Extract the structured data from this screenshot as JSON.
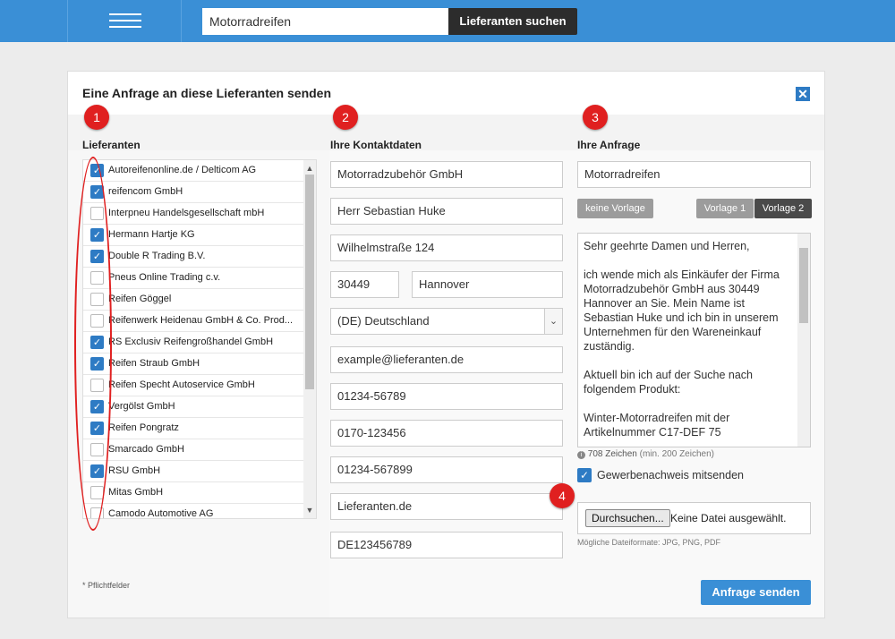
{
  "header": {
    "search_value": "Motorradreifen",
    "search_button": "Lieferanten suchen"
  },
  "dialog": {
    "title": "Eine Anfrage an diese Lieferanten senden",
    "close_icon": "close-icon",
    "steps": [
      "1",
      "2",
      "3",
      "4"
    ],
    "required_note": "* Pflichtfelder",
    "submit_label": "Anfrage senden"
  },
  "suppliers": {
    "heading": "Lieferanten",
    "items": [
      {
        "label": "Autoreifenonline.de / Delticom AG",
        "checked": true
      },
      {
        "label": "reifencom GmbH",
        "checked": true
      },
      {
        "label": "Interpneu Handelsgesellschaft mbH",
        "checked": false
      },
      {
        "label": "Hermann Hartje KG",
        "checked": true
      },
      {
        "label": "Double R Trading B.V.",
        "checked": true
      },
      {
        "label": "Pneus Online Trading c.v.",
        "checked": false
      },
      {
        "label": "Reifen Göggel",
        "checked": false
      },
      {
        "label": "Reifenwerk Heidenau GmbH & Co. Prod...",
        "checked": false
      },
      {
        "label": "RS Exclusiv Reifengroßhandel GmbH",
        "checked": true
      },
      {
        "label": "Reifen Straub GmbH",
        "checked": true
      },
      {
        "label": "Reifen Specht Autoservice GmbH",
        "checked": false
      },
      {
        "label": "Vergölst GmbH",
        "checked": true
      },
      {
        "label": "Reifen Pongratz",
        "checked": true
      },
      {
        "label": "Smarcado GmbH",
        "checked": false
      },
      {
        "label": "RSU GmbH",
        "checked": true
      },
      {
        "label": "Mitas GmbH",
        "checked": false
      },
      {
        "label": "Camodo Automotive AG",
        "checked": false
      }
    ]
  },
  "contact": {
    "heading": "Ihre Kontaktdaten",
    "company": "Motorradzubehör GmbH",
    "name": "Herr Sebastian Huke",
    "street": "Wilhelmstraße 124",
    "zip": "30449",
    "city": "Hannover",
    "country": "(DE) Deutschland",
    "email": "example@lieferanten.de",
    "phone": "01234-56789",
    "mobile": "0170-123456",
    "fax": "01234-567899",
    "website": "Lieferanten.de",
    "vat_id": "DE123456789"
  },
  "request": {
    "heading": "Ihre Anfrage",
    "subject": "Motorradreifen",
    "template_none": "keine Vorlage",
    "template_1": "Vorlage 1",
    "template_2": "Vorlage 2",
    "message": "Sehr geehrte Damen und Herren,\n\nich wende mich als Einkäufer der Firma Motorradzubehör GmbH aus 30449 Hannover an Sie. Mein Name ist Sebastian Huke und ich bin in unserem Unternehmen für den Wareneinkauf zuständig.\n\nAktuell bin ich auf der Suche nach folgendem Produkt:\n\nWinter-Motorradreifen mit der Artikelnummer C17-DEF 75",
    "char_count": "708 Zeichen",
    "char_min": "(min. 200 Zeichen)",
    "trade_proof_label": "Gewerbenachweis mitsenden",
    "file_button": "Durchsuchen...",
    "file_status": "Keine Datei ausgewählt.",
    "file_formats": "Mögliche Dateiformate: JPG, PNG, PDF"
  }
}
